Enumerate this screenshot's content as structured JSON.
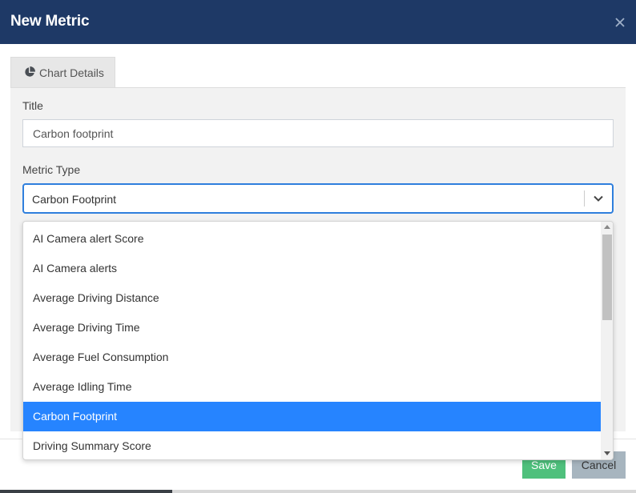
{
  "modal": {
    "title": "New Metric",
    "close_icon": "close-icon"
  },
  "tabs": [
    {
      "label": "Chart Details",
      "icon": "pie-chart-icon",
      "active": true
    }
  ],
  "form": {
    "title_label": "Title",
    "title_value": "Carbon footprint",
    "metric_type_label": "Metric Type",
    "metric_type_value": "Carbon Footprint"
  },
  "dropdown": {
    "options": [
      "AI Camera alert Score",
      "AI Camera alerts",
      "Average Driving Distance",
      "Average Driving Time",
      "Average Fuel Consumption",
      "Average Idling Time",
      "Carbon Footprint",
      "Driving Summary Score"
    ],
    "selected": "Carbon Footprint"
  },
  "footer": {
    "save_label": "Save",
    "cancel_label": "Cancel"
  },
  "colors": {
    "header_bg": "#1e3966",
    "select_focus": "#2f7fdd",
    "option_selected": "#2684ff",
    "save_bg": "#4fc07c",
    "cancel_bg": "#a7b5bf"
  }
}
